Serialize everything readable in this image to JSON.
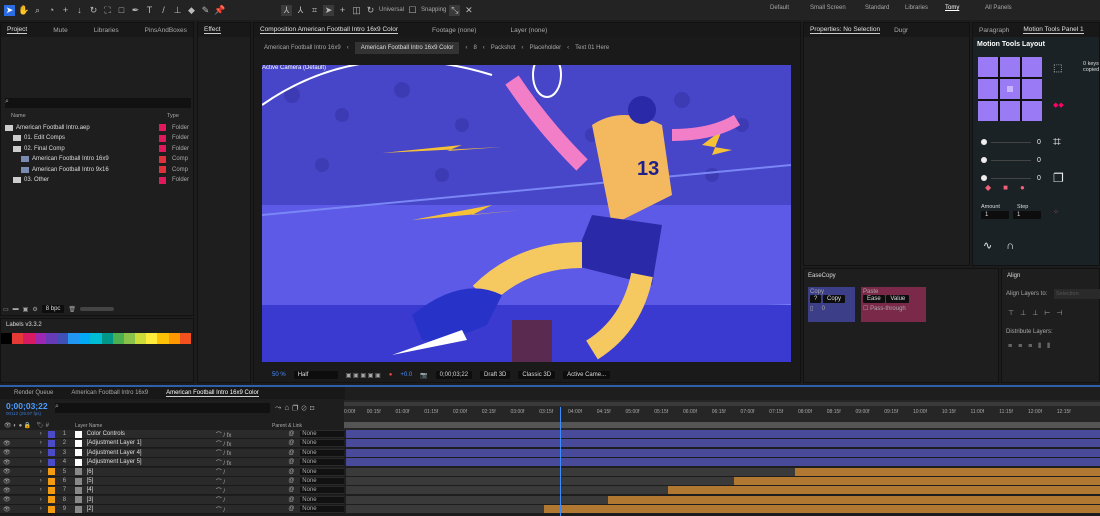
{
  "toolbar": {
    "universal": "Universal",
    "snapping": "Snapping"
  },
  "workspaces": [
    "Default",
    "Small Screen",
    "Standard",
    "Libraries",
    "Tomy",
    "All Panels"
  ],
  "project": {
    "tabs": [
      "Project",
      "Mute",
      "Libraries",
      "PinsAndBoxes"
    ],
    "effects_tab": "Effect",
    "col_name": "Name",
    "col_type": "Type",
    "items": [
      {
        "name": "American Football Intro.aep",
        "type": "Folder",
        "indent": 0,
        "color": "#e0185c"
      },
      {
        "name": "01. Edit Comps",
        "type": "Folder",
        "indent": 1,
        "color": "#e0185c"
      },
      {
        "name": "02. Final Comp",
        "type": "Folder",
        "indent": 1,
        "color": "#e0185c"
      },
      {
        "name": "American Football Intro 16x9",
        "type": "Comp",
        "indent": 2,
        "color": "#e0303a"
      },
      {
        "name": "American Football Intro 9x16",
        "type": "Comp",
        "indent": 2,
        "color": "#e0303a"
      },
      {
        "name": "03. Other",
        "type": "Folder",
        "indent": 1,
        "color": "#e0185c"
      }
    ],
    "bpc": "8 bpc"
  },
  "labels": {
    "title": "Labels v3.3.2",
    "colors": [
      "#000000",
      "#e53935",
      "#d81b60",
      "#9c27b0",
      "#673ab7",
      "#3f51b5",
      "#2196f3",
      "#03a9f4",
      "#00bcd4",
      "#009688",
      "#4caf50",
      "#8bc34a",
      "#cddc39",
      "#ffeb3b",
      "#ffc107",
      "#ff9800",
      "#f4511e"
    ]
  },
  "comp": {
    "tabs": [
      "Composition American Football Intro 16x9 Color",
      "Footage (none)",
      "Layer (none)"
    ],
    "breadcrumbs": [
      "American Football Intro 16x9",
      "American Football Intro 16x9 Color",
      "8",
      "Packshot",
      "Placeholder",
      "Text 01 Here"
    ],
    "camera_label": "Active Camera (Default)",
    "jersey": "13",
    "footer": {
      "zoom": "50 %",
      "resolution": "Half",
      "exposure": "+0.0",
      "timecode": "0;00;03;22",
      "draft": "Draft 3D",
      "renderer": "Classic 3D",
      "view": "Active Came..."
    }
  },
  "properties": {
    "tabs": [
      "Properties: No Selection",
      "Dugr"
    ]
  },
  "motion_tools": {
    "tabs": [
      "Paragraph",
      "Motion Tools Panel 1"
    ],
    "layout": "Motion Tools Layout",
    "keys_text": "0 keys copied",
    "sliders": [
      "0",
      "0",
      "0"
    ],
    "amount_label": "Amount",
    "step_label": "Step",
    "amount": "1",
    "step": "1"
  },
  "easecopy": {
    "title": "EaseCopy",
    "copy_label": "Copy",
    "q": "?",
    "copy_btn": "Copy",
    "count": "0",
    "paste_label": "Paste",
    "ease": "Ease",
    "value": "Value",
    "pass": "Pass-through"
  },
  "align": {
    "title": "Align",
    "align_to": "Align Layers to:",
    "selection": "Selection",
    "distribute": "Distribute Layers:"
  },
  "timeline": {
    "tabs": [
      "Render Queue",
      "American Football Intro 16x9",
      "American Football Intro 16x9 Color"
    ],
    "timecode": "0;00;03;22",
    "fps": "00112 (29.97 fps)",
    "col_name": "Layer Name",
    "col_parent": "Parent & Link",
    "ruler": [
      "0:00f",
      "00:15f",
      "01:00f",
      "01:15f",
      "02:00f",
      "02:15f",
      "03:00f",
      "03:15f",
      "04:00f",
      "04:15f",
      "05:00f",
      "05:15f",
      "06:00f",
      "06:15f",
      "07:00f",
      "07:15f",
      "08:00f",
      "08:15f",
      "09:00f",
      "09:15f",
      "10:00f",
      "10:15f",
      "11:00f",
      "11:15f",
      "12:00f",
      "12:15f"
    ],
    "playhead_sec": 3.73,
    "layers": [
      {
        "num": "1",
        "name": "Color Controls",
        "label": "#4b4bc8",
        "parent": "None",
        "start_sec": 0,
        "fx": true
      },
      {
        "num": "2",
        "name": "[Adjustment Layer 1]",
        "label": "#4b4bc8",
        "parent": "None",
        "start_sec": 0,
        "fx": true
      },
      {
        "num": "3",
        "name": "[Adjustment Layer 4]",
        "label": "#4b4bc8",
        "parent": "None",
        "start_sec": 0,
        "fx": true
      },
      {
        "num": "4",
        "name": "[Adjustment Layer 5]",
        "label": "#4b4bc8",
        "parent": "None",
        "start_sec": 0,
        "fx": true
      },
      {
        "num": "5",
        "name": "[6]",
        "label": "#f39c12",
        "parent": "None",
        "start_sec": 7.8,
        "fx": false
      },
      {
        "num": "6",
        "name": "[5]",
        "label": "#f39c12",
        "parent": "None",
        "start_sec": 6.75,
        "fx": false
      },
      {
        "num": "7",
        "name": "[4]",
        "label": "#f39c12",
        "parent": "None",
        "start_sec": 5.6,
        "fx": false
      },
      {
        "num": "8",
        "name": "[3]",
        "label": "#f39c12",
        "parent": "None",
        "start_sec": 4.55,
        "fx": false
      },
      {
        "num": "9",
        "name": "[2]",
        "label": "#f39c12",
        "parent": "None",
        "start_sec": 3.45,
        "fx": false
      }
    ]
  }
}
